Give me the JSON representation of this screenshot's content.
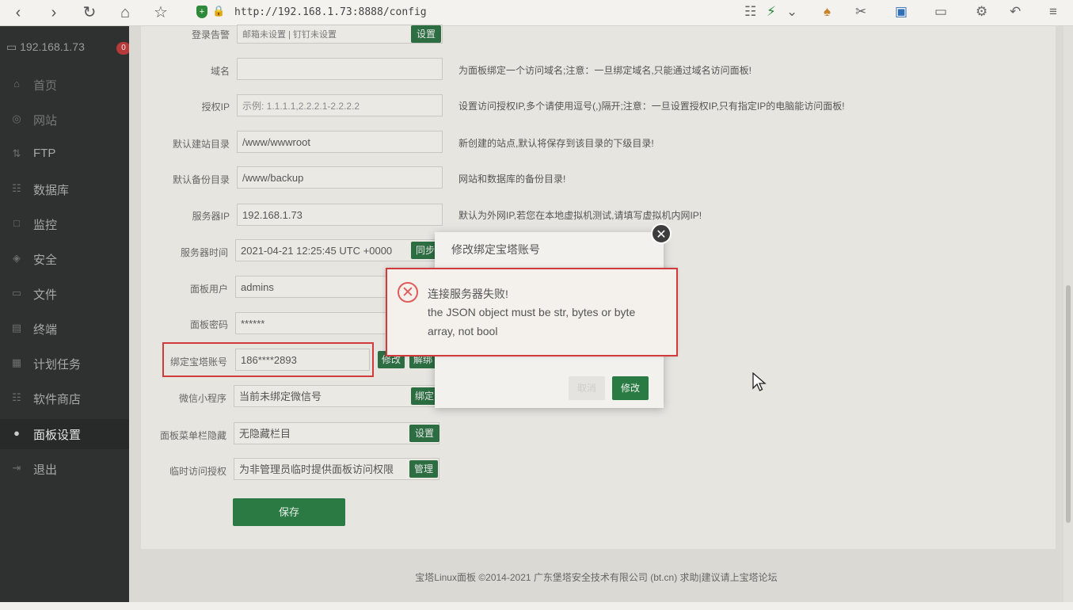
{
  "browser": {
    "url": "http://192.168.1.73:8888/config"
  },
  "sidebar": {
    "server_ip": "192.168.1.73",
    "badge": "0",
    "items": [
      {
        "label": "首页",
        "icon": "home-icon"
      },
      {
        "label": "网站",
        "icon": "globe-icon"
      },
      {
        "label": "FTP",
        "icon": "ftp-icon"
      },
      {
        "label": "数据库",
        "icon": "database-icon"
      },
      {
        "label": "监控",
        "icon": "monitor-icon"
      },
      {
        "label": "安全",
        "icon": "shield-icon"
      },
      {
        "label": "文件",
        "icon": "folder-icon"
      },
      {
        "label": "终端",
        "icon": "terminal-icon"
      },
      {
        "label": "计划任务",
        "icon": "calendar-icon"
      },
      {
        "label": "软件商店",
        "icon": "grid-icon"
      },
      {
        "label": "面板设置",
        "icon": "gear-icon"
      },
      {
        "label": "退出",
        "icon": "logout-icon"
      }
    ]
  },
  "settings": {
    "alert": {
      "label": "登录告警",
      "value": "邮箱未设置 | 钉钉未设置",
      "btn": "设置"
    },
    "domain": {
      "label": "域名",
      "value": "",
      "hint": "为面板绑定一个访问域名;注意：一旦绑定域名,只能通过域名访问面板!"
    },
    "auth_ip": {
      "label": "授权IP",
      "placeholder": "示例: 1.1.1.1,2.2.2.1-2.2.2.2",
      "hint": "设置访问授权IP,多个请使用逗号(,)隔开;注意：一旦设置授权IP,只有指定IP的电脑能访问面板!"
    },
    "site_dir": {
      "label": "默认建站目录",
      "value": "/www/wwwroot",
      "hint": "新创建的站点,默认将保存到该目录的下级目录!"
    },
    "backup_dir": {
      "label": "默认备份目录",
      "value": "/www/backup",
      "hint": "网站和数据库的备份目录!"
    },
    "server_ip": {
      "label": "服务器IP",
      "value": "192.168.1.73",
      "hint": "默认为外网IP,若您在本地虚拟机测试,请填写虚拟机内网IP!"
    },
    "server_time": {
      "label": "服务器时间",
      "value": "2021-04-21 12:25:45 UTC +0000",
      "btn": "同步"
    },
    "panel_user": {
      "label": "面板用户",
      "value": "admins"
    },
    "panel_pass": {
      "label": "面板密码",
      "value": "******"
    },
    "bt_account": {
      "label": "绑定宝塔账号",
      "value": "186****2893",
      "btn_modify": "修改",
      "btn_unbind": "解绑"
    },
    "wechat": {
      "label": "微信小程序",
      "value": "当前未绑定微信号",
      "btn": "绑定"
    },
    "menu_hide": {
      "label": "面板菜单栏隐藏",
      "value": "无隐藏栏目",
      "btn": "设置"
    },
    "temp_auth": {
      "label": "临时访问授权",
      "value": "为非管理员临时提供面板访问权限",
      "btn": "管理"
    },
    "save": "保存"
  },
  "dialog": {
    "title": "修改绑定宝塔账号",
    "cancel": "取消",
    "ok": "修改"
  },
  "error": {
    "title": "连接服务器失败!",
    "message": "the JSON object must be str, bytes or byte array, not bool"
  },
  "footer": "宝塔Linux面板 ©2014-2021 广东堡塔安全技术有限公司 (bt.cn)   求助|建议请上宝塔论坛"
}
